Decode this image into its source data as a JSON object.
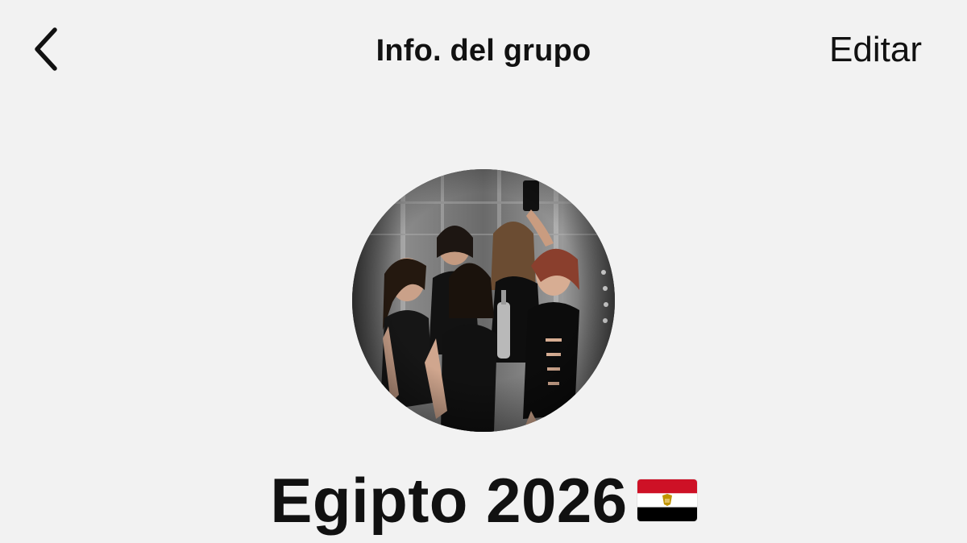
{
  "header": {
    "title": "Info. del grupo",
    "edit_label": "Editar",
    "back_icon": "chevron-left-icon"
  },
  "group": {
    "name": "Egipto 2026",
    "flag_emoji": "🇪🇬",
    "flag_icon": "egypt-flag-icon",
    "avatar_icon": "group-photo"
  },
  "colors": {
    "background": "#f2f2f2",
    "text": "#111111",
    "flag_red": "#ce1126",
    "flag_white": "#ffffff",
    "flag_black": "#000000",
    "flag_eagle": "#c09300"
  }
}
